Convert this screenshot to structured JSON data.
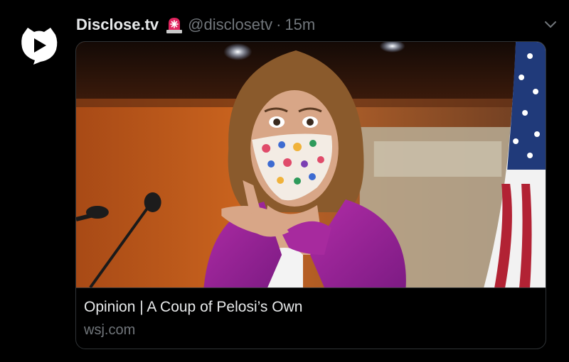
{
  "tweet": {
    "display_name": "Disclose.tv",
    "badge_emoji": "siren-icon",
    "handle": "@disclosetv",
    "separator": "·",
    "time": "15m",
    "menu_icon": "chevron-down-icon"
  },
  "avatar": {
    "icon": "disclose-logo-icon"
  },
  "link_card": {
    "title": "Opinion | A Coup of Pelosi’s Own",
    "domain": "wsj.com",
    "image": "press-conference-photo"
  },
  "colors": {
    "background": "#000000",
    "text_primary": "#e7e9ea",
    "text_secondary": "#71767b",
    "border": "#2f3336"
  }
}
